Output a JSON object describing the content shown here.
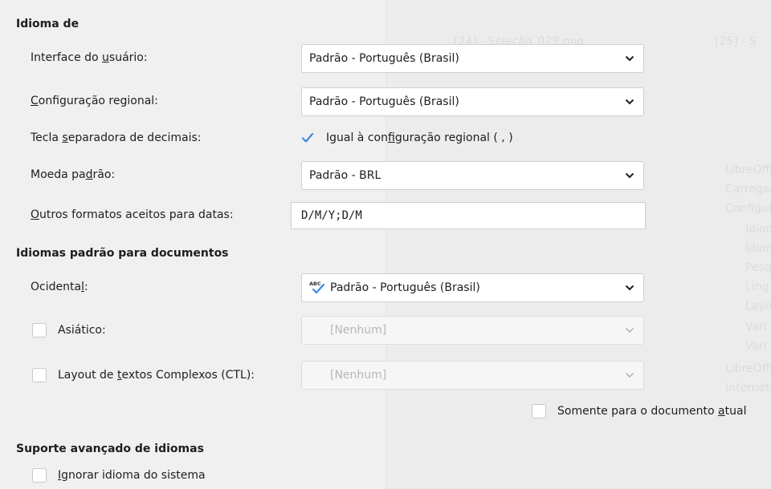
{
  "sections": {
    "language_of": "Idioma de",
    "default_languages": "Idiomas padrão para documentos",
    "enhanced_support": "Suporte avançado de idiomas"
  },
  "fields": {
    "ui_label": [
      "Interface do ",
      "u",
      "suário:"
    ],
    "ui_value": "Padrão - Português (Brasil)",
    "locale_label": [
      "",
      "C",
      "onfiguração regional:"
    ],
    "locale_value": "Padrão - Português (Brasil)",
    "decimal_label": [
      "Tecla ",
      "s",
      "eparadora de decimais:"
    ],
    "decimal_check_label": [
      "Igual à con",
      "f",
      "iguração regional ( , )"
    ],
    "currency_label": [
      "Moeda pa",
      "d",
      "rão:"
    ],
    "currency_value": "Padrão - BRL",
    "date_label": [
      "",
      "O",
      "utros formatos aceitos para datas:"
    ],
    "date_value": "D/M/Y;D/M",
    "western_label": [
      "Ocidenta",
      "l",
      ":"
    ],
    "western_value": "Padrão - Português (Brasil)",
    "asian_label": "Asiático:",
    "asian_value": "[Nenhum]",
    "ctl_label": [
      "Layout de ",
      "t",
      "extos Complexos (CTL):"
    ],
    "ctl_value": "[Nenhum]",
    "current_doc_label": [
      "Somente para o documento ",
      "a",
      "tual"
    ],
    "ignore_system_label": [
      "",
      "I",
      "gnorar idioma do sistema"
    ]
  },
  "background_hint": {
    "title_fragment_1": "[24] - Seleção_029.png",
    "title_fragment_2": "[25] - S",
    "tree_items": [
      "LibreOffi",
      "Carregar",
      "Configura",
      "Idiom",
      "Idiom",
      "Pesq",
      "Ling",
      "Layo",
      "Vari",
      "Vari",
      "LibreOffi",
      "Internet"
    ]
  },
  "colors": {
    "accent": "#3d8be0",
    "background": "#f0f0f0",
    "field_bg": "#ffffff",
    "border": "#cfcfcf"
  },
  "icons": {
    "dropdown": "chevron-down-icon",
    "spellcheck": "spellcheck-icon",
    "check": "checkmark-icon"
  }
}
